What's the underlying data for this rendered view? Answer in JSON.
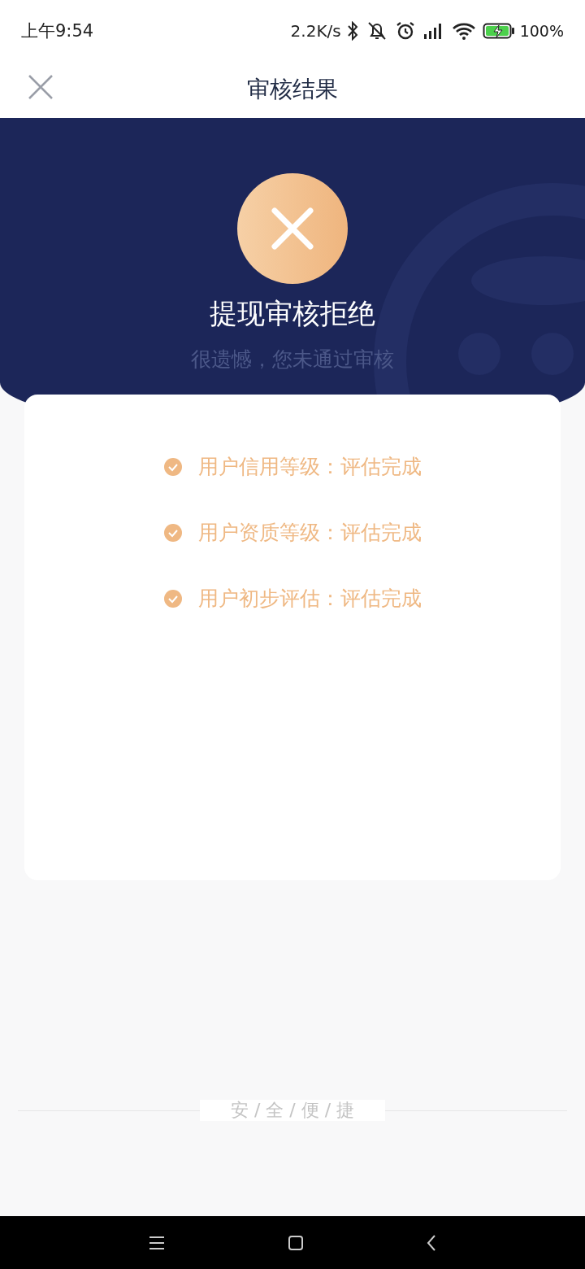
{
  "status_bar": {
    "time": "上午9:54",
    "speed": "2.2K/s",
    "battery": "100%"
  },
  "header": {
    "title": "审核结果"
  },
  "result": {
    "title": "提现审核拒绝",
    "subtitle": "很遗憾，您未通过审核"
  },
  "checks": [
    {
      "text": "用户信用等级：评估完成"
    },
    {
      "text": "用户资质等级：评估完成"
    },
    {
      "text": "用户初步评估：评估完成"
    }
  ],
  "footer": {
    "slogan": "安 / 全 / 便 / 捷"
  }
}
